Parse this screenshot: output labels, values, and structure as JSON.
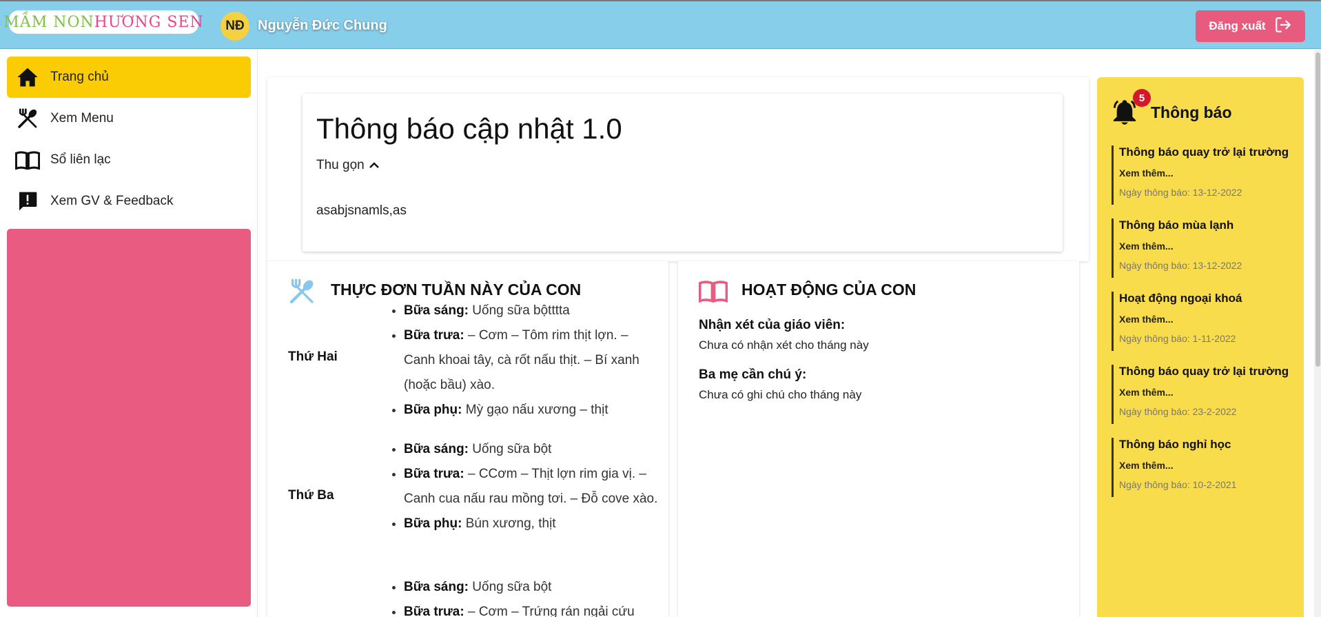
{
  "header": {
    "logo_part1": "MẦM NON ",
    "logo_part2": "HƯƠNG SEN",
    "avatar_initials": "NĐ",
    "username": "Nguyễn Đức Chung",
    "logout_label": "Đăng xuất",
    "logout_icon": "logout-icon"
  },
  "sidebar": {
    "items": [
      {
        "label": "Trang chủ",
        "icon": "home-icon",
        "active": true
      },
      {
        "label": "Xem Menu",
        "icon": "utensils-icon",
        "active": false
      },
      {
        "label": "Sổ liên lạc",
        "icon": "book-icon",
        "active": false
      },
      {
        "label": "Xem GV & Feedback",
        "icon": "feedback-icon",
        "active": false
      }
    ]
  },
  "update": {
    "title": "Thông báo cập nhật 1.0",
    "collapse_label": "Thu gọn",
    "body": "asabjsnamls,as"
  },
  "menu": {
    "title": "THỰC ĐƠN TUẦN NÀY CỦA CON",
    "days": [
      {
        "day": "Thứ Hai",
        "meals": [
          {
            "label": "Bữa sáng:",
            "text": " Uống sữa bộtttta"
          },
          {
            "label": "Bữa trưa:",
            "text": " – Cơm – Tôm rim thịt lợn. – Canh khoai tây, cà rốt nấu thịt. – Bí xanh (hoặc bầu) xào."
          },
          {
            "label": "Bữa phụ:",
            "text": " Mỳ gạo nấu xương – thịt"
          }
        ]
      },
      {
        "day": "Thứ Ba",
        "meals": [
          {
            "label": "Bữa sáng:",
            "text": " Uống sữa bột"
          },
          {
            "label": "Bữa trưa:",
            "text": " – CCơm – Thịt lợn rim gia vị. – Canh cua nấu rau mồng tơi. – Đỗ cove xào."
          },
          {
            "label": "Bữa phụ:",
            "text": " Bún xương, thịt"
          }
        ]
      },
      {
        "day": "",
        "meals": [
          {
            "label": "Bữa sáng:",
            "text": " Uống sữa bột"
          },
          {
            "label": "Bữa trưa:",
            "text": " – Cơm – Trứng rán ngải cứu"
          }
        ]
      }
    ]
  },
  "activity": {
    "title": "HOẠT ĐỘNG CỦA CON",
    "teacher_comment_label": "Nhận xét của giáo viên:",
    "teacher_comment_value": "Chưa có nhận xét cho tháng này",
    "parent_note_label": "Ba mẹ cần chú ý:",
    "parent_note_value": "Chưa có ghi chú cho tháng này"
  },
  "notifications": {
    "title": "Thông báo",
    "count": "5",
    "items": [
      {
        "title": "Thông báo quay trở lại trường",
        "more": "Xem thêm...",
        "date": "Ngày thông báo: 13-12-2022"
      },
      {
        "title": "Thông báo mùa lạnh",
        "more": "Xem thêm...",
        "date": "Ngày thông báo: 13-12-2022"
      },
      {
        "title": "Hoạt động ngoại khoá",
        "more": "Xem thêm...",
        "date": "Ngày thông báo: 1-11-2022"
      },
      {
        "title": "Thông báo quay trở lại trường",
        "more": "Xem thêm...",
        "date": "Ngày thông báo: 23-2-2022"
      },
      {
        "title": "Thông báo nghỉ học",
        "more": "Xem thêm...",
        "date": "Ngày thông báo: 10-2-2021"
      }
    ]
  },
  "colors": {
    "header_bg": "#87CEEB",
    "active_nav": "#fbcc02",
    "pink": "#e95b80",
    "notif_bg": "#f9dc4c",
    "badge": "#d3182e"
  }
}
